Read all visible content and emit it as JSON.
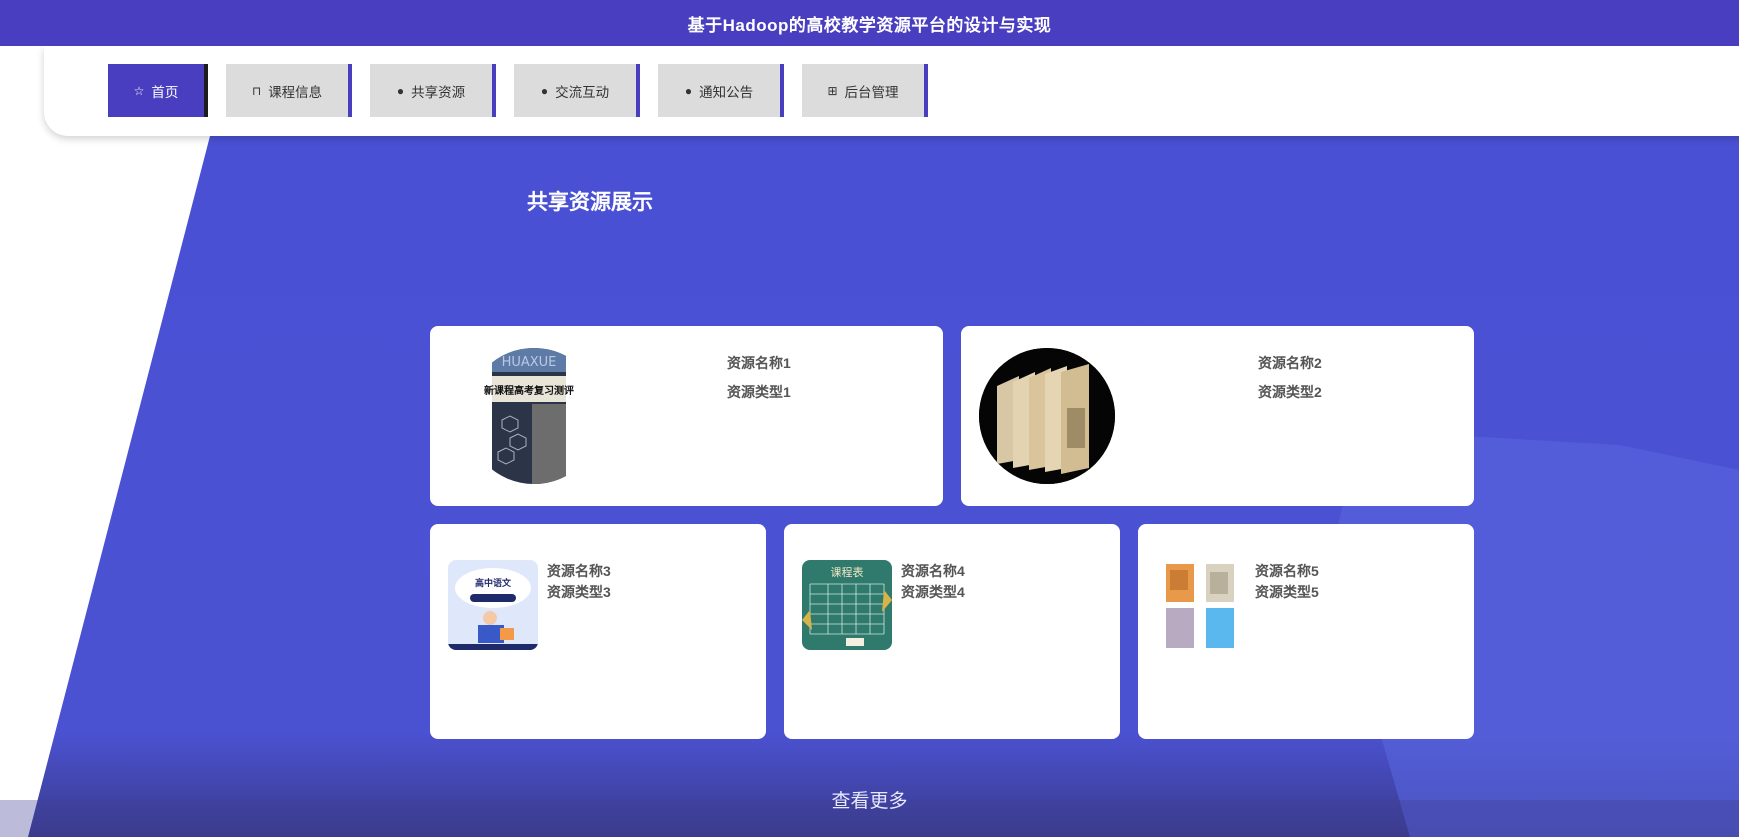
{
  "header": {
    "title": "基于Hadoop的高校教学资源平台的设计与实现"
  },
  "nav": [
    {
      "label": "首页",
      "icon": "star-icon",
      "glyph": "☆",
      "active": true
    },
    {
      "label": "课程信息",
      "icon": "bag-icon",
      "glyph": "⊓",
      "active": false
    },
    {
      "label": "共享资源",
      "icon": "info-icon",
      "glyph": "●",
      "active": false
    },
    {
      "label": "交流互动",
      "icon": "help-icon",
      "glyph": "●",
      "active": false
    },
    {
      "label": "通知公告",
      "icon": "info-icon",
      "glyph": "●",
      "active": false
    },
    {
      "label": "后台管理",
      "icon": "gift-icon",
      "glyph": "⊞",
      "active": false
    }
  ],
  "section": {
    "title": "共享资源展示"
  },
  "resources": [
    {
      "name": "资源名称1",
      "type": "资源类型1"
    },
    {
      "name": "资源名称2",
      "type": "资源类型2"
    },
    {
      "name": "资源名称3",
      "type": "资源类型3"
    },
    {
      "name": "资源名称4",
      "type": "资源类型4"
    },
    {
      "name": "资源名称5",
      "type": "资源类型5"
    }
  ],
  "thumbnails": {
    "book1": {
      "top_text": "HUAXUE",
      "cover_title": "新课程高考复习测评"
    },
    "book3": {
      "banner": "高中语文"
    },
    "book4": {
      "banner": "课程表"
    }
  },
  "more_link": "查看更多",
  "colors": {
    "brand": "#4a3ec0",
    "hero": "#4b50d3",
    "nav_bg": "#dcdcdc"
  }
}
